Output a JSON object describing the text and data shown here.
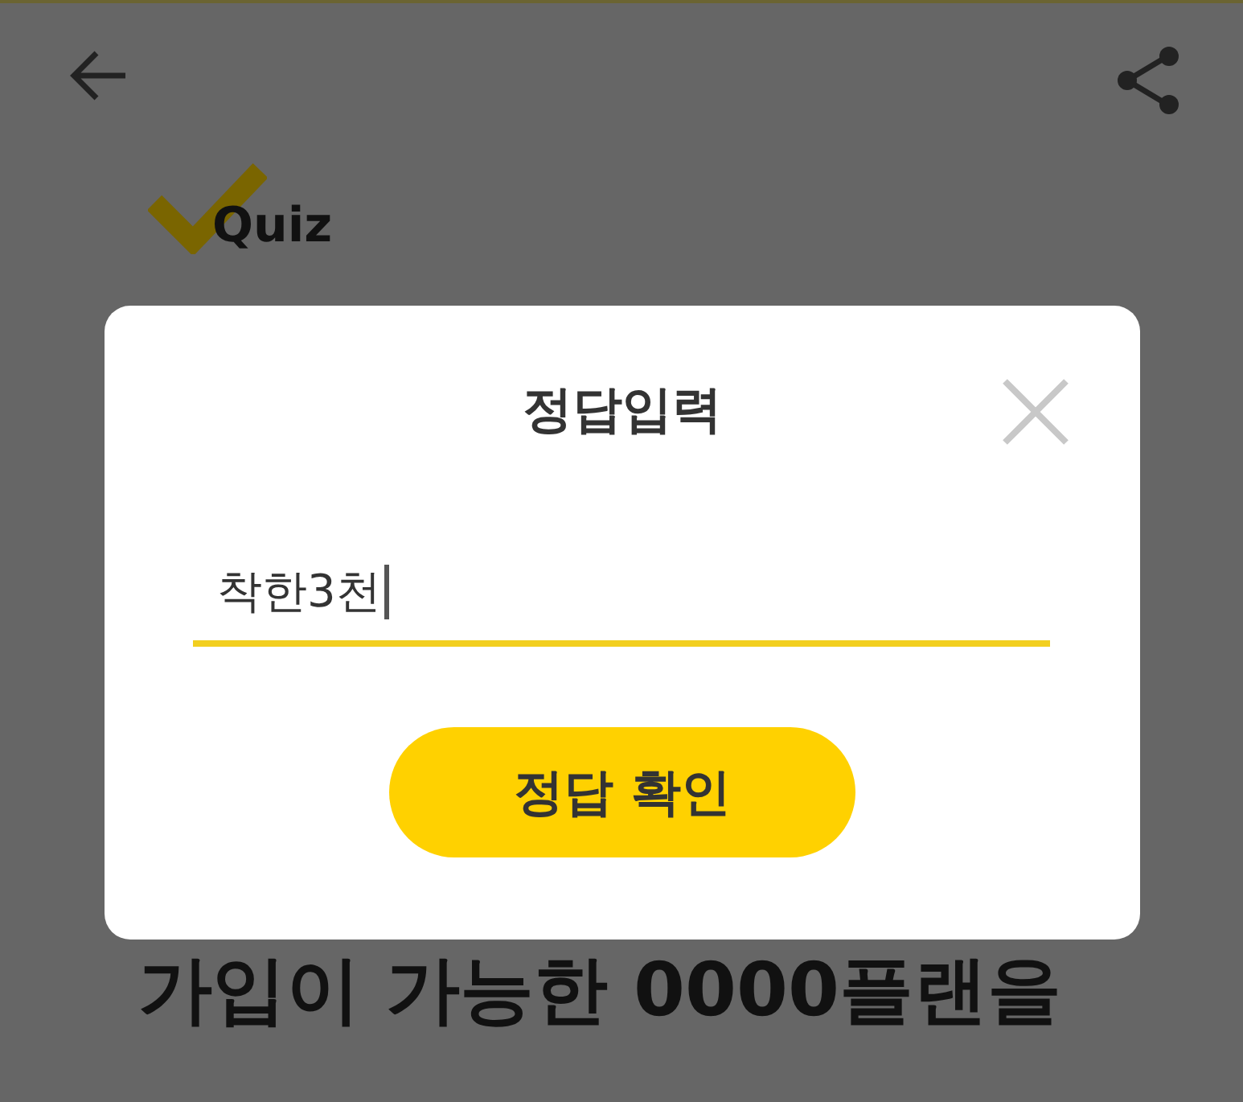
{
  "header": {
    "logo": {
      "text": "Quiz"
    }
  },
  "question": {
    "visible_line": "가입이 가능한 0000플랜을"
  },
  "dialog": {
    "title": "정답입력",
    "answer": {
      "value": "착한3천"
    },
    "submit_button": "정답 확인"
  }
}
